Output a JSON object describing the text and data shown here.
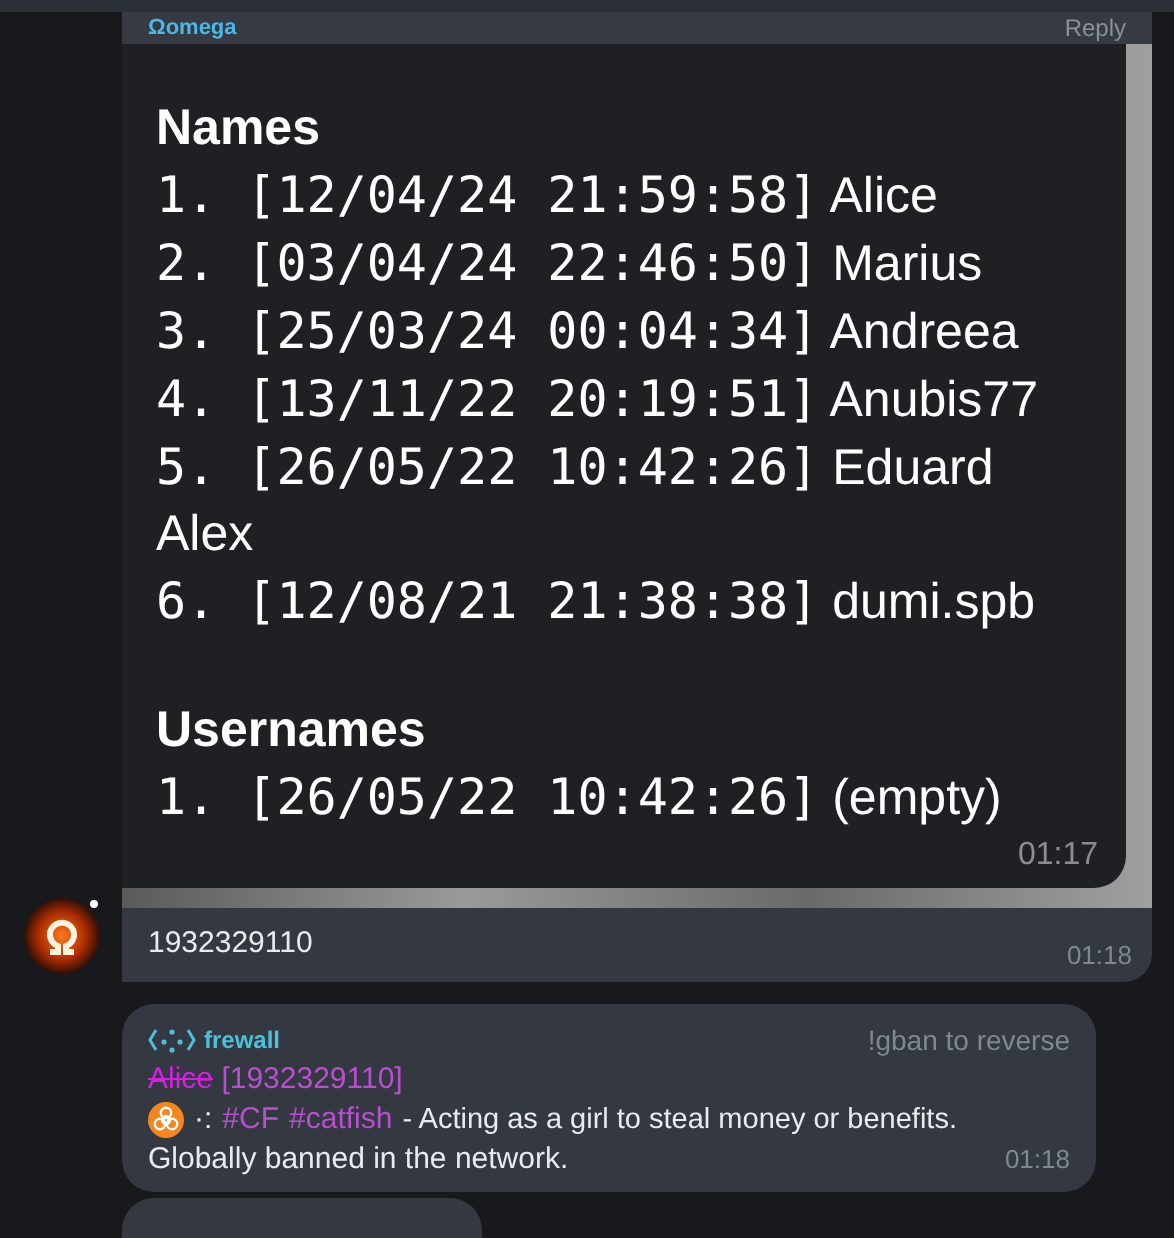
{
  "reply_header": {
    "sender": "Ωomega",
    "action": "Reply"
  },
  "image_message": {
    "sections": [
      {
        "title": "Names",
        "entries": [
          {
            "index": "1.",
            "time": "[12/04/24 21:59:58]",
            "name": "Alice"
          },
          {
            "index": "2.",
            "time": "[03/04/24 22:46:50]",
            "name": "Marius"
          },
          {
            "index": "3.",
            "time": "[25/03/24 00:04:34]",
            "name": "Andreea"
          },
          {
            "index": "4.",
            "time": "[13/11/22 20:19:51]",
            "name": "Anubis77"
          },
          {
            "index": "5.",
            "time": "[26/05/22 10:42:26]",
            "name": "Eduard Alex"
          },
          {
            "index": "6.",
            "time": "[12/08/21 21:38:38]",
            "name": "dumi.spb"
          }
        ]
      },
      {
        "title": "Usernames",
        "entries": [
          {
            "index": "1.",
            "time": "[26/05/22 10:42:26]",
            "name": "(empty)"
          }
        ]
      }
    ],
    "time": "01:17",
    "caption": "1932329110",
    "caption_time": "01:18"
  },
  "ban_message": {
    "sender": "frewall",
    "hint": "!gban to reverse",
    "user": "Alice",
    "user_id": "[1932329110]",
    "separator": "·:",
    "tags": [
      "#CF",
      "#catfish"
    ],
    "reason": "- Acting as a girl to steal money or benefits.",
    "note": "Globally banned in the network.",
    "time": "01:18"
  }
}
